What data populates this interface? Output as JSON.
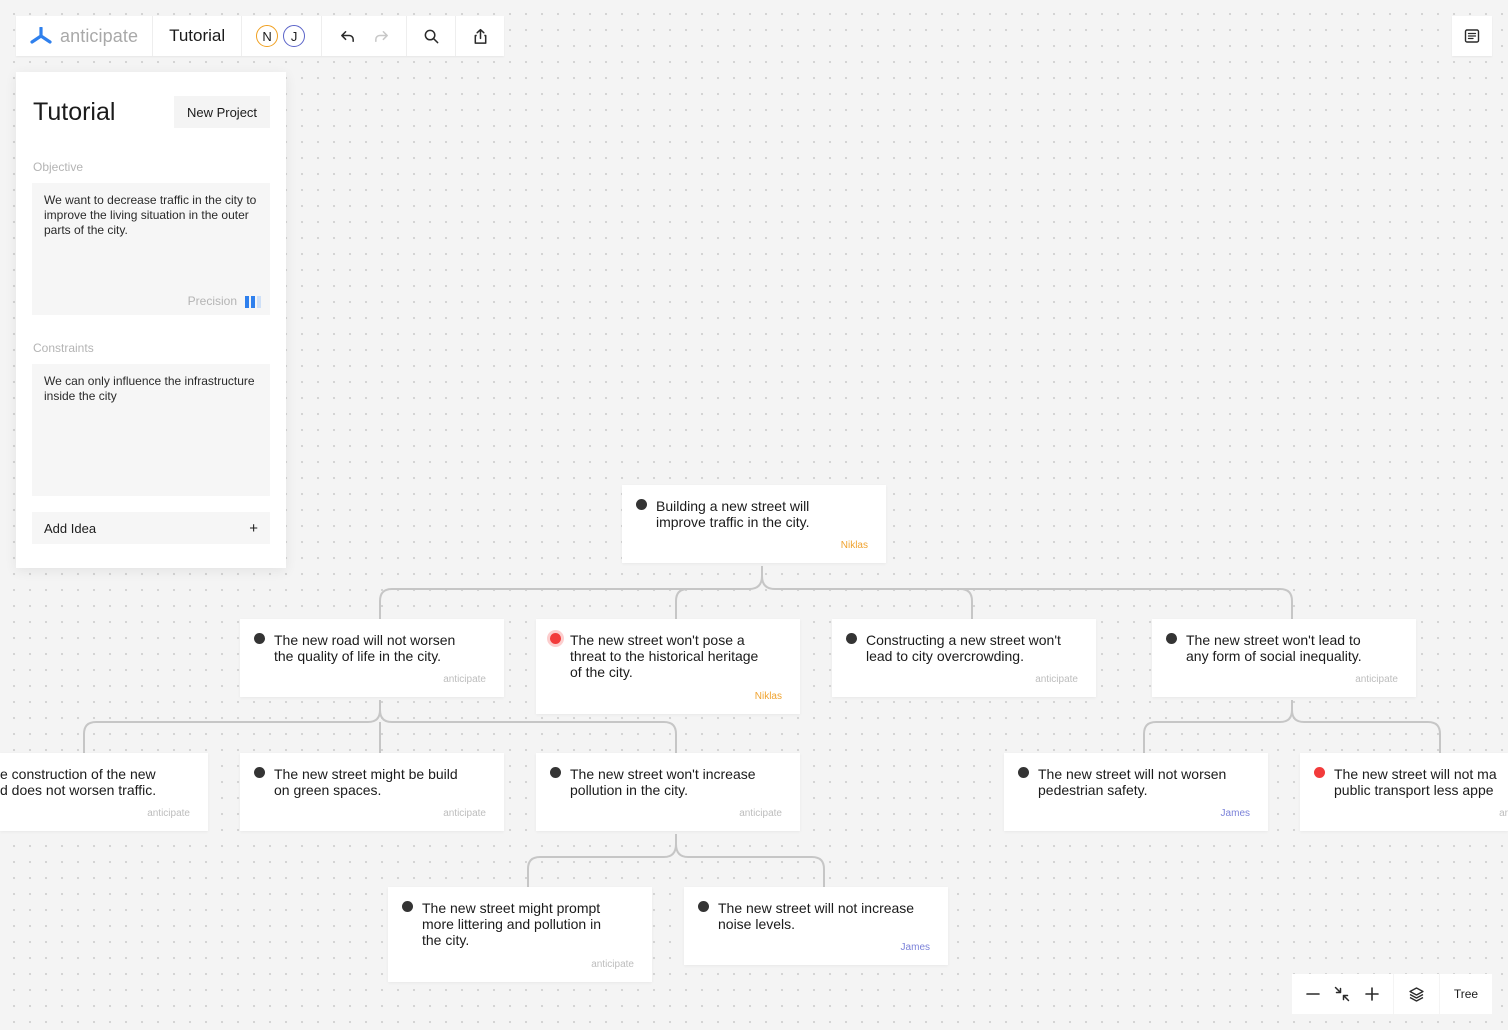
{
  "toolbar": {
    "brand": "anticipate",
    "project_title": "Tutorial",
    "avatars": [
      "N",
      "J"
    ]
  },
  "panel": {
    "title": "Tutorial",
    "new_project_label": "New Project",
    "objective_label": "Objective",
    "objective_text": "We want to decrease traffic in the city to improve the living situation in the outer parts of the city.",
    "precision_label": "Precision",
    "precision_level": {
      "filled": 2,
      "total": 3
    },
    "constraints_label": "Constraints",
    "constraints_text": "We can only influence the infrastructure inside the city",
    "add_idea_label": "Add Idea"
  },
  "nodes": {
    "root": {
      "lines": [
        "Building a new street will",
        "improve traffic in the city."
      ],
      "author": "Niklas"
    },
    "n_quality": {
      "lines": [
        "The new road will not worsen",
        "the quality of life in the city."
      ],
      "author": "anticipate"
    },
    "n_heritage": {
      "lines": [
        "The new street won't pose a",
        "threat to the historical heritage",
        "of the city."
      ],
      "author": "Niklas"
    },
    "n_overcrowding": {
      "lines": [
        "Constructing a new street won't",
        "lead to city overcrowding."
      ],
      "author": "anticipate"
    },
    "n_inequality": {
      "lines": [
        "The new street won't lead to",
        "any form of social inequality."
      ],
      "author": "anticipate"
    },
    "n_traffic": {
      "lines": [
        "e construction of the new",
        "d does not worsen traffic."
      ],
      "author": "anticipate"
    },
    "n_green": {
      "lines": [
        "The new street might be build",
        "on green spaces."
      ],
      "author": "anticipate"
    },
    "n_pollution": {
      "lines": [
        "The new street won't increase",
        "pollution in the city."
      ],
      "author": "anticipate"
    },
    "n_pedestrian": {
      "lines": [
        "The new street will not worsen",
        "pedestrian safety."
      ],
      "author": "James"
    },
    "n_transport": {
      "lines": [
        "The new street will not ma",
        "public transport less appe"
      ],
      "author": "ar"
    },
    "n_littering": {
      "lines": [
        "The new street might prompt",
        "more littering and pollution in",
        "the city."
      ],
      "author": "anticipate"
    },
    "n_noise": {
      "lines": [
        "The new street will not increase",
        "noise levels."
      ],
      "author": "James"
    }
  },
  "controls": {
    "view_mode": "Tree"
  },
  "colors": {
    "niklas": "#f0a330",
    "james": "#7b82d9",
    "alert": "#f23b3b",
    "brand_blue": "#2f80ed"
  }
}
